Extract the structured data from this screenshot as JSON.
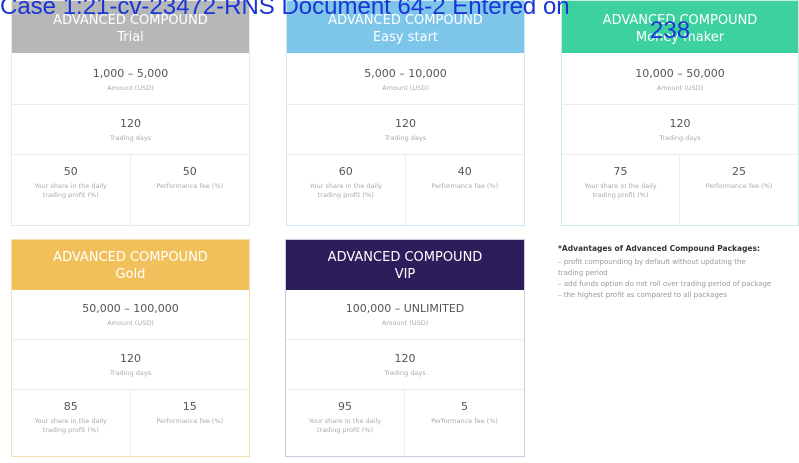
{
  "stamp": {
    "line1": "Case 1:21-cv-23472-RNS   Document 64-2   Entered on",
    "line2": "238"
  },
  "colors": {
    "trial": "#b5b7b9",
    "easy": "#7dc6ea",
    "money": "#3dd1a0",
    "gold": "#f2c05b",
    "vip": "#2b1e5b"
  },
  "packages": [
    {
      "key": "trial",
      "name": "ADVANCED COMPOUND",
      "tier": "Trial",
      "amount": "1,000 – 5,000",
      "amount_label": "Amount (USD)",
      "days": "120",
      "days_label": "Trading days",
      "share": "50",
      "share_label": "Your share in the daily trading profit (%)",
      "fee": "50",
      "fee_label": "Performance fee (%)"
    },
    {
      "key": "easy",
      "name": "ADVANCED COMPOUND",
      "tier": "Easy start",
      "amount": "5,000 – 10,000",
      "amount_label": "Amount (USD)",
      "days": "120",
      "days_label": "Trading days",
      "share": "60",
      "share_label": "Your share in the daily trading profit (%)",
      "fee": "40",
      "fee_label": "Performance fee (%)"
    },
    {
      "key": "money",
      "name": "ADVANCED COMPOUND",
      "tier": "Money maker",
      "amount": "10,000 – 50,000",
      "amount_label": "Amount (USD)",
      "days": "120",
      "days_label": "Trading days",
      "share": "75",
      "share_label": "Your share in the daily trading profit (%)",
      "fee": "25",
      "fee_label": "Performance fee (%)"
    },
    {
      "key": "gold",
      "name": "ADVANCED COMPOUND",
      "tier": "Gold",
      "amount": "50,000 – 100,000",
      "amount_label": "Amount (USD)",
      "days": "120",
      "days_label": "Trading days",
      "share": "85",
      "share_label": "Your share in the daily trading profit (%)",
      "fee": "15",
      "fee_label": "Performance fee (%)"
    },
    {
      "key": "vip",
      "name": "ADVANCED COMPOUND",
      "tier": "VIP",
      "amount": "100,000 – UNLIMITED",
      "amount_label": "Amount (USD)",
      "days": "120",
      "days_label": "Trading days",
      "share": "95",
      "share_label": "Your share in the daily trading profit (%)",
      "fee": "5",
      "fee_label": "Performance fee (%)"
    }
  ],
  "advantages": {
    "title": "*Advantages of Advanced Compound Packages:",
    "items": [
      "– profit compounding by default without updating the",
      "trading period",
      "– add funds option do not roll over trading period of package",
      "– the highest profit as compared to all packages"
    ]
  }
}
